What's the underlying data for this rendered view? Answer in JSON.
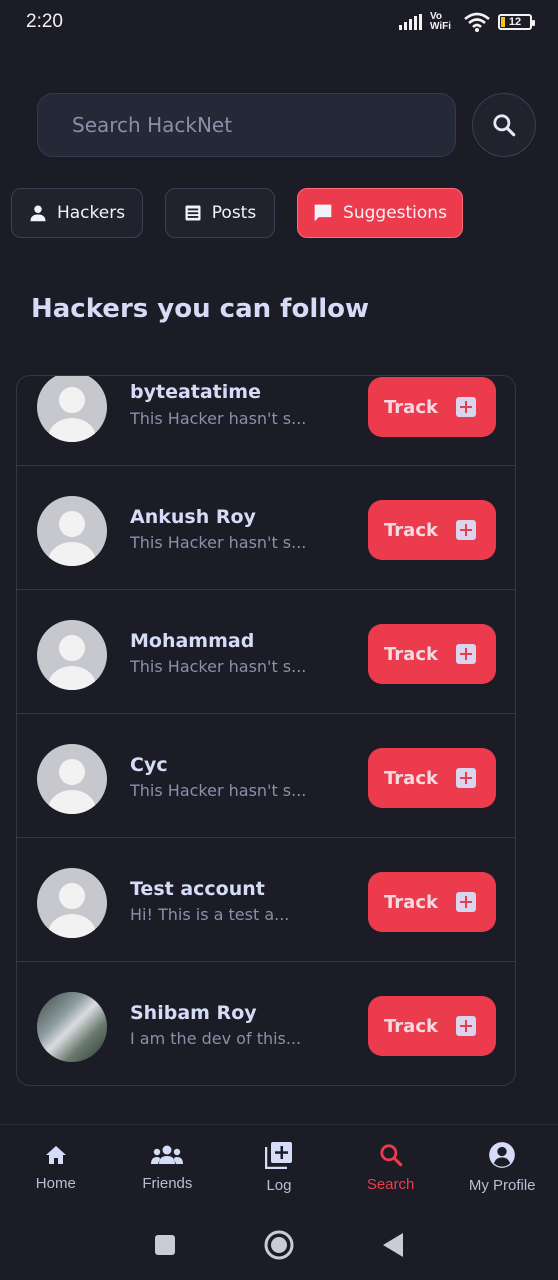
{
  "status_bar": {
    "time": "2:20",
    "network": "Vo WiFi",
    "battery": "12"
  },
  "search": {
    "placeholder": "Search HackNet",
    "button_icon": "search-icon"
  },
  "filters": [
    {
      "label": "Hackers",
      "icon": "person-icon",
      "active": false
    },
    {
      "label": "Posts",
      "icon": "document-icon",
      "active": false
    },
    {
      "label": "Suggestions",
      "icon": "chat-icon",
      "active": true
    }
  ],
  "section_title": "Hackers you can follow",
  "suggestions": [
    {
      "name": "byteatatime",
      "bio": "This Hacker hasn't s...",
      "action": "Track",
      "avatar": "default"
    },
    {
      "name": "Ankush Roy",
      "bio": "This Hacker hasn't s...",
      "action": "Track",
      "avatar": "default"
    },
    {
      "name": "Mohammad",
      "bio": "This Hacker hasn't s...",
      "action": "Track",
      "avatar": "default"
    },
    {
      "name": "Cyc",
      "bio": "This Hacker hasn't s...",
      "action": "Track",
      "avatar": "default"
    },
    {
      "name": "Test account",
      "bio": "Hi! This is a test a...",
      "action": "Track",
      "avatar": "default"
    },
    {
      "name": "Shibam Roy",
      "bio": "I am the dev of this...",
      "action": "Track",
      "avatar": "photo"
    }
  ],
  "bottom_nav": [
    {
      "label": "Home",
      "icon": "home-icon",
      "active": false
    },
    {
      "label": "Friends",
      "icon": "people-icon",
      "active": false
    },
    {
      "label": "Log",
      "icon": "add-box-icon",
      "active": false
    },
    {
      "label": "Search",
      "icon": "search-icon",
      "active": true
    },
    {
      "label": "My Profile",
      "icon": "account-circle-icon",
      "active": false
    }
  ],
  "colors": {
    "background": "#1b1c26",
    "accent": "#ec3b4d",
    "text_primary": "#d6dcf7",
    "text_secondary": "#8a90aa"
  }
}
